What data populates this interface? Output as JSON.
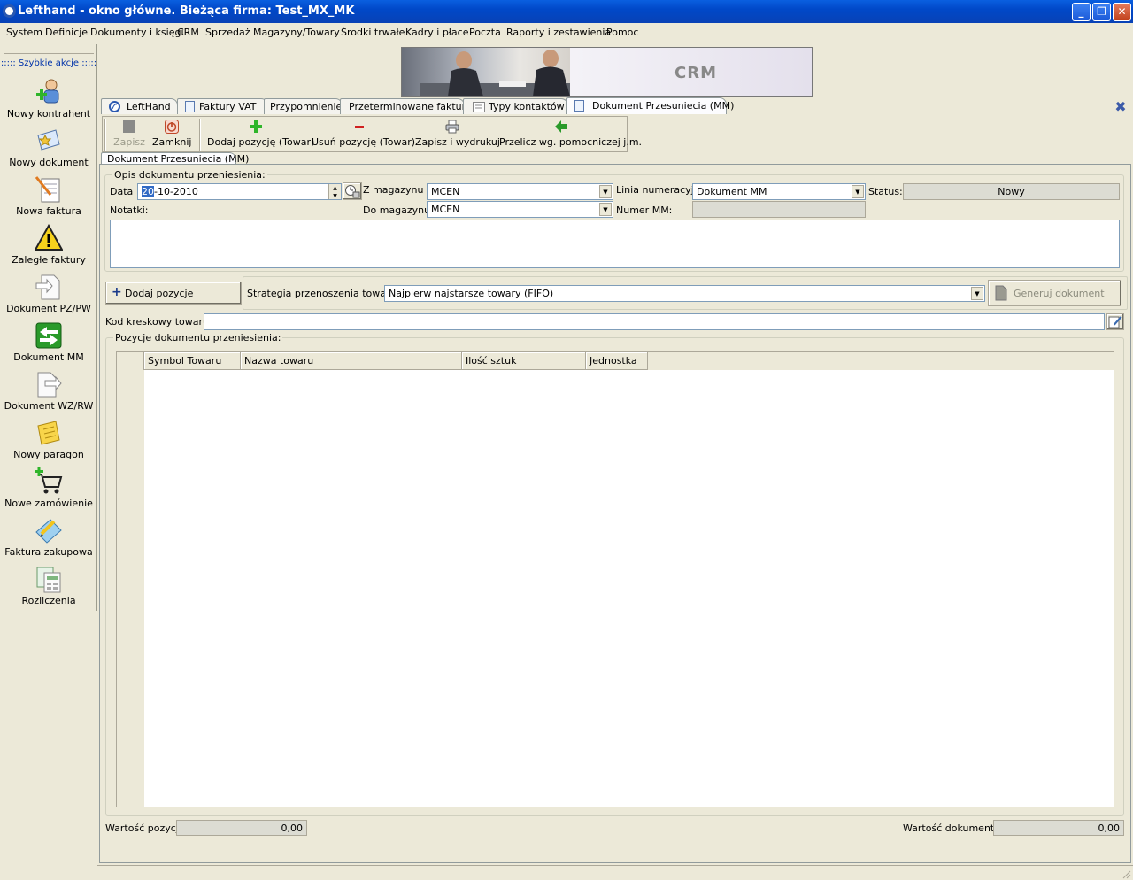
{
  "window": {
    "title": "Lefthand - okno główne. Bieżąca firma: Test_MX_MK",
    "min": "_",
    "restore": "❐",
    "close": "✕"
  },
  "menu": [
    "System",
    "Definicje",
    "Dokumenty i księgi",
    "CRM",
    "Sprzedaż",
    "Magazyny/Towary",
    "Środki trwałe",
    "Kadry i płace",
    "Poczta",
    "Raporty i zestawienia",
    "Pomoc"
  ],
  "sidebar": {
    "title": "::::: Szybkie akcje :::::",
    "items": [
      {
        "label": "Nowy kontrahent",
        "icon": "person-add-icon"
      },
      {
        "label": "Nowy dokument",
        "icon": "new-document-icon"
      },
      {
        "label": "Nowa faktura",
        "icon": "invoice-icon"
      },
      {
        "label": "Zaległe faktury",
        "icon": "warning-icon"
      },
      {
        "label": "Dokument PZ/PW",
        "icon": "document-in-icon"
      },
      {
        "label": "Dokument MM",
        "icon": "transfer-arrows-icon"
      },
      {
        "label": "Dokument WZ/RW",
        "icon": "document-out-icon"
      },
      {
        "label": "Nowy paragon",
        "icon": "receipt-icon"
      },
      {
        "label": "Nowe zamówienie",
        "icon": "cart-add-icon"
      },
      {
        "label": "Faktura zakupowa",
        "icon": "purchase-invoice-icon"
      },
      {
        "label": "Rozliczenia",
        "icon": "settlements-icon"
      }
    ]
  },
  "banner": {
    "text": "CRM"
  },
  "tabs": [
    {
      "label": "LeftHand",
      "icon": "lefthand-logo-icon"
    },
    {
      "label": "Faktury VAT",
      "icon": "page-icon"
    },
    {
      "label": "Przypomnienie"
    },
    {
      "label": "Przeterminowane faktury"
    },
    {
      "label": "Typy kontaktów",
      "icon": "list-icon"
    },
    {
      "label": "Dokument Przesuniecia (MM)",
      "icon": "page-icon",
      "active": true
    }
  ],
  "tab_close": "✖",
  "toolbar": {
    "save": "Zapisz",
    "close": "Zamknij",
    "add_item": "Dodaj pozycję (Towar)",
    "remove_item": "Usuń pozycję (Towar)",
    "save_print": "Zapisz i wydrukuj",
    "recalc": "Przelicz wg. pomocniczej j.m."
  },
  "doc_tab": "Dokument Przesuniecia (MM)",
  "form": {
    "legend": "Opis dokumentu przeniesienia:",
    "date_label": "Data",
    "date_value_sel": "20",
    "date_value_rest": "-10-2010",
    "from_wh_label": "Z magazynu",
    "from_wh_value": "MCEN",
    "to_wh_label": "Do magazynu",
    "to_wh_value": "MCEN",
    "numline_label": "Linia numeracyjna",
    "numline_value": "Dokument MM",
    "mmnum_label": "Numer MM:",
    "mmnum_value": "",
    "status_label": "Status:",
    "status_value": "Nowy",
    "notes_label": "Notatki:",
    "notes_value": ""
  },
  "actions": {
    "add_items": "Dodaj pozycje",
    "add_plus": "+",
    "strategy_label": "Strategia przenoszenia towarów:",
    "strategy_value": "Najpierw najstarsze towary (FIFO)",
    "generate": "Generuj dokument",
    "barcode_label": "Kod kreskowy towaru:",
    "barcode_value": ""
  },
  "items": {
    "legend": "Pozycje dokumentu przeniesienia:",
    "columns": [
      "Symbol Towaru",
      "Nazwa towaru",
      "Ilość sztuk",
      "Jednostka"
    ],
    "rows": []
  },
  "footer": {
    "items_value_label": "Wartość pozycji:",
    "items_value": "0,00",
    "doc_value_label": "Wartość dokumentu:",
    "doc_value": "0,00"
  }
}
